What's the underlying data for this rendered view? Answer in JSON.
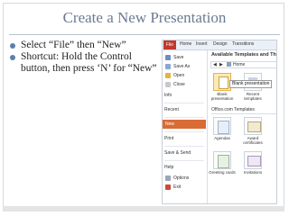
{
  "slide": {
    "title": "Create a New Presentation",
    "bullets": [
      "Select “File” then “New”",
      "Shortcut: Hold the Control button, then press ‘N’ for “New”"
    ]
  },
  "screenshot": {
    "ribbon_tabs": [
      "File",
      "Home",
      "Insert",
      "Design",
      "Transitions"
    ],
    "menu": {
      "items": [
        {
          "label": "Save",
          "icon": "save-icon"
        },
        {
          "label": "Save As",
          "icon": "save-as-icon"
        },
        {
          "label": "Open",
          "icon": "open-folder-icon"
        },
        {
          "label": "Close",
          "icon": "close-file-icon"
        },
        {
          "label": "Info",
          "icon": ""
        },
        {
          "label": "Recent",
          "icon": ""
        },
        {
          "label": "New",
          "icon": ""
        },
        {
          "label": "Print",
          "icon": ""
        },
        {
          "label": "Save & Send",
          "icon": ""
        },
        {
          "label": "Help",
          "icon": ""
        },
        {
          "label": "Options",
          "icon": "options-icon"
        },
        {
          "label": "Exit",
          "icon": "exit-icon"
        }
      ],
      "selected": "New"
    },
    "panel_title": "Available Templates and Th",
    "nav": {
      "back": "◀",
      "forward": "▶",
      "home": "Home"
    },
    "tiles_top": [
      {
        "label": "Blank presentation"
      },
      {
        "label": "Recent templates"
      }
    ],
    "tooltip": "Blank presentation",
    "section": "Office.com Templates",
    "tiles_bottom": [
      {
        "label": "Agendas"
      },
      {
        "label": "Award certificates"
      },
      {
        "label": "Greeting cards"
      },
      {
        "label": "Invitations"
      }
    ],
    "colors": {
      "file_tab": "#c0392b",
      "new_highlight": "#d96b34",
      "title": "#6b7a91",
      "bullet": "#5a7fb0"
    }
  }
}
